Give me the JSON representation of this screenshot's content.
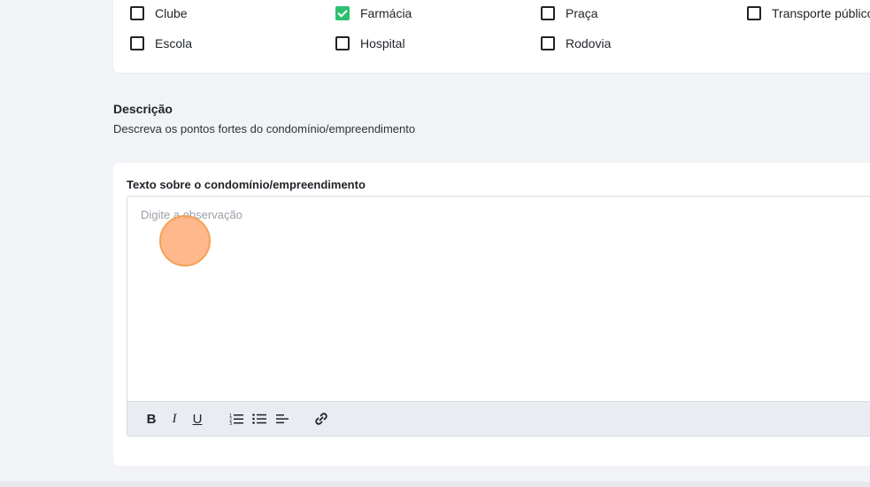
{
  "amenities": {
    "row1": [
      {
        "label": "Clube",
        "checked": false
      },
      {
        "label": "Farmácia",
        "checked": true
      },
      {
        "label": "Praça",
        "checked": false
      },
      {
        "label": "Transporte público",
        "checked": false
      }
    ],
    "row2": [
      {
        "label": "Escola",
        "checked": false
      },
      {
        "label": "Hospital",
        "checked": false
      },
      {
        "label": "Rodovia",
        "checked": false
      }
    ]
  },
  "description": {
    "title": "Descrição",
    "subtitle": "Descreva os pontos fortes do condomínio/empreendimento"
  },
  "editor": {
    "label": "Texto sobre o condomínio/empreendimento",
    "placeholder": "Digite a observação",
    "toolbar": {
      "bold": "B",
      "italic": "I",
      "underline": "U"
    }
  },
  "colors": {
    "checked": "#2fbf71",
    "background": "#f1f3f7",
    "toolbar_bg": "#e9ecf1"
  }
}
